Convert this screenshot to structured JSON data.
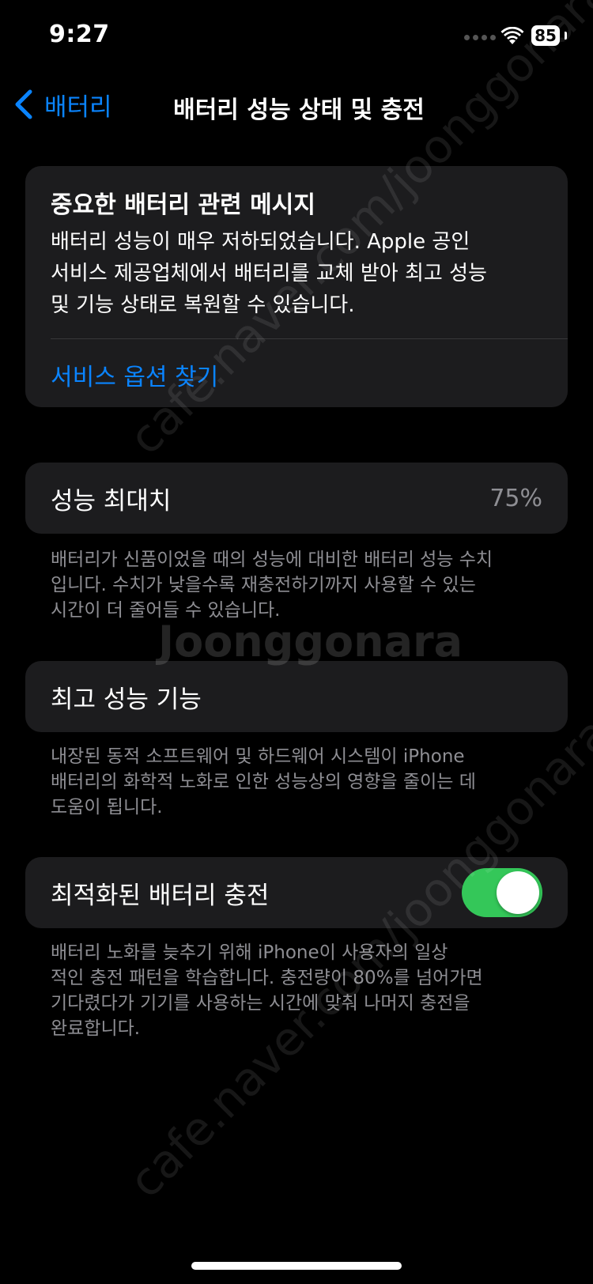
{
  "status_bar": {
    "time": "9:27",
    "battery_level": "85"
  },
  "nav": {
    "back_label": "배터리",
    "title": "배터리 성능 상태 및 충전"
  },
  "alert": {
    "title": "중요한 배터리 관련 메시지",
    "lines": [
      "배터리 성능이 매우 저하되었습니다. Apple 공인",
      "서비스 제공업체에서 배터리를 교체 받아 최고 성능",
      "및 기능 상태로 복원할 수 있습니다."
    ],
    "link_label": "서비스 옵션 찾기"
  },
  "max_capacity": {
    "label": "성능 최대치",
    "value": "75%",
    "footnote": [
      "배터리가 신품이었을 때의 성능에 대비한 배터리 성능 수치",
      "입니다. 수치가 낮을수록 재충전하기까지 사용할 수 있는",
      "시간이 더 줄어들 수 있습니다."
    ]
  },
  "peak_performance": {
    "label": "최고 성능 기능",
    "footnote": [
      "내장된 동적 소프트웨어 및 하드웨어 시스템이 iPhone",
      "배터리의 화학적 노화로 인한 성능상의 영향을 줄이는 데",
      "도움이 됩니다."
    ]
  },
  "optimized_charging": {
    "label": "최적화된 배터리 충전",
    "enabled": true,
    "footnote": [
      "배터리 노화를 늦추기 위해 iPhone이 사용자의 일상",
      "적인 충전 패턴을 학습합니다. 충전량이 80%를 넘어가면",
      "기다렸다가 기기를 사용하는 시간에 맞춰 나머지 충전을",
      "완료합니다."
    ]
  },
  "watermark": {
    "brand": "Joonggonara",
    "url": "cafe.naver.com/joonggonara"
  },
  "colors": {
    "accent": "#0a84ff",
    "toggle_on": "#34c759",
    "card_bg": "#1c1c1e"
  }
}
